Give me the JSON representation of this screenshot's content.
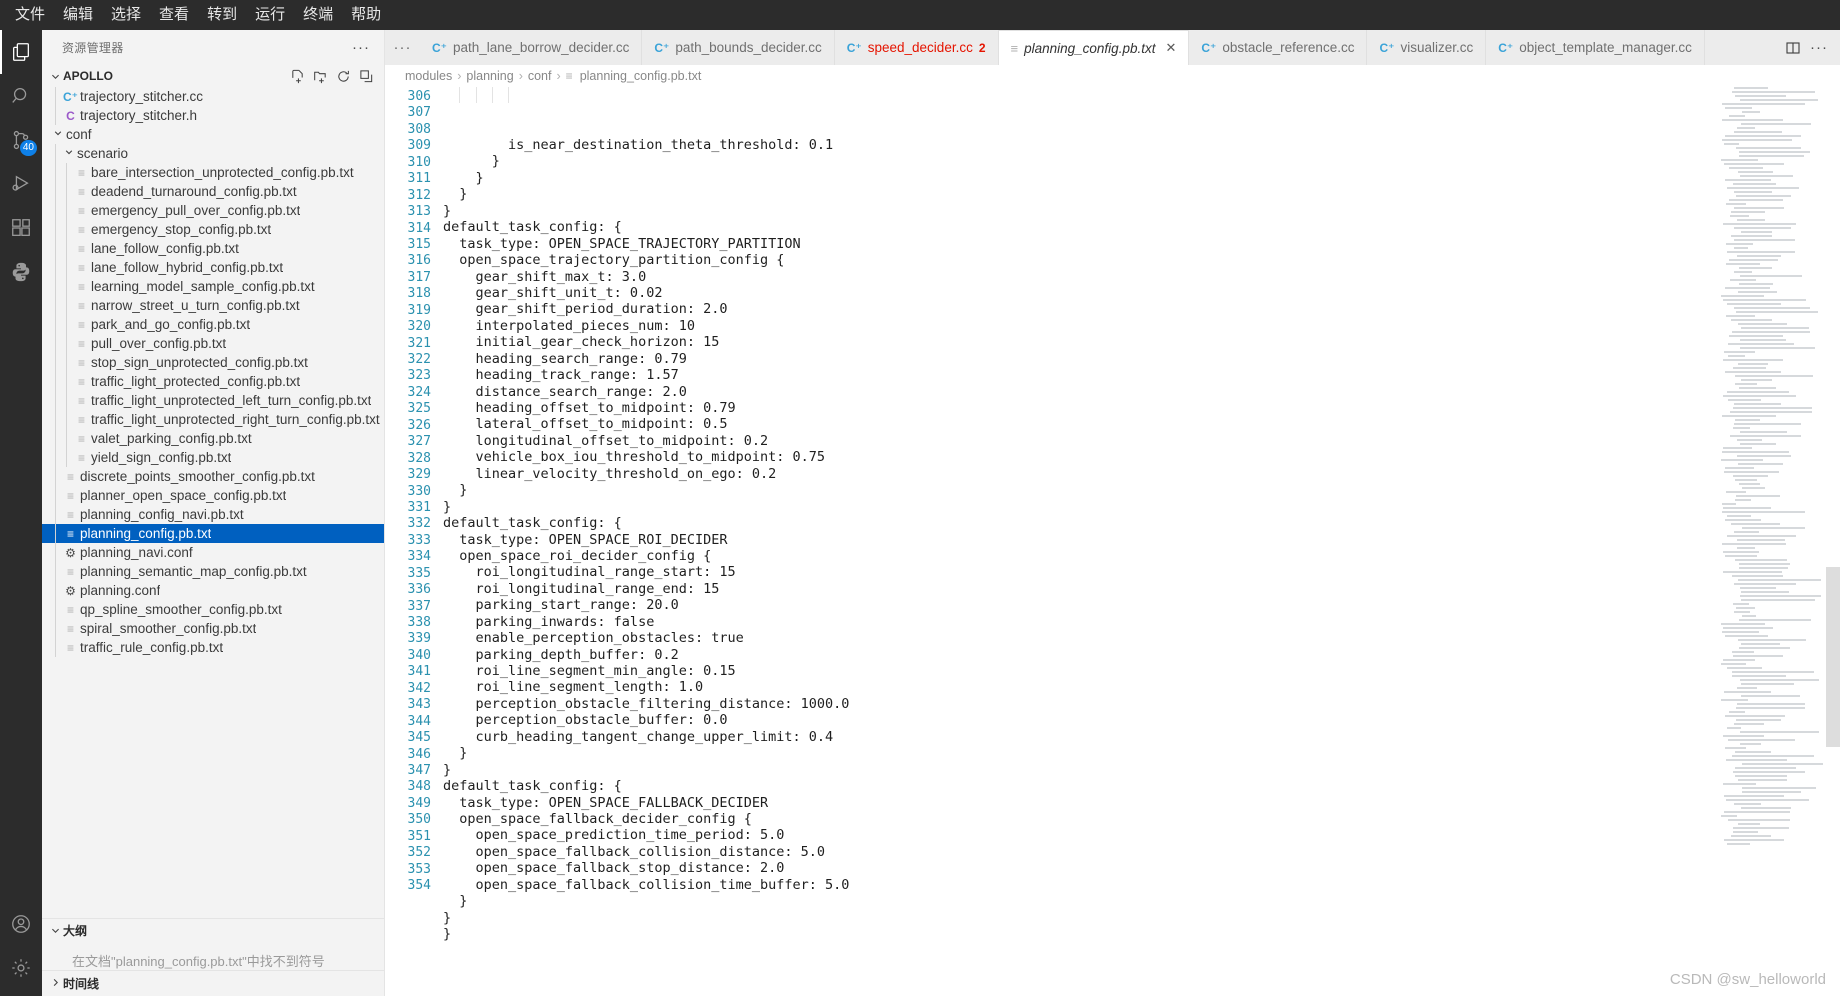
{
  "menubar": {
    "items": [
      "文件",
      "编辑",
      "选择",
      "查看",
      "转到",
      "运行",
      "终端",
      "帮助"
    ]
  },
  "activitybar": {
    "items": [
      {
        "name": "explorer",
        "icon": "files-icon",
        "active": true,
        "badge": null
      },
      {
        "name": "search",
        "icon": "search-icon",
        "active": false,
        "badge": null
      },
      {
        "name": "source-control",
        "icon": "source-control-icon",
        "active": false,
        "badge": "40"
      },
      {
        "name": "run-debug",
        "icon": "run-and-debug-icon",
        "active": false,
        "badge": null
      },
      {
        "name": "extensions",
        "icon": "extensions-icon",
        "active": false,
        "badge": null
      },
      {
        "name": "python",
        "icon": "python-icon",
        "active": false,
        "badge": null
      }
    ],
    "bottom": [
      {
        "name": "accounts",
        "icon": "account-icon"
      },
      {
        "name": "manage",
        "icon": "gear-icon"
      }
    ]
  },
  "sidebar": {
    "title": "资源管理器",
    "more_label": "···",
    "explorer_section": {
      "label": "APOLLO",
      "caret": "⌄",
      "actions": [
        "new-file-icon",
        "new-folder-icon",
        "refresh-icon",
        "collapse-all-icon"
      ]
    },
    "tree": [
      {
        "label": "trajectory_stitcher.cc",
        "icon": "cpp-file-icon",
        "depth": 3,
        "type": "cc"
      },
      {
        "label": "trajectory_stitcher.h",
        "icon": "header-file-icon",
        "depth": 3,
        "type": "h"
      },
      {
        "label": "conf",
        "icon": "folder-icon",
        "depth": 2,
        "type": "folder",
        "expanded": true
      },
      {
        "label": "scenario",
        "icon": "folder-icon",
        "depth": 3,
        "type": "folder",
        "expanded": true
      },
      {
        "label": "bare_intersection_unprotected_config.pb.txt",
        "icon": "text-file-icon",
        "depth": 4,
        "type": "txt"
      },
      {
        "label": "deadend_turnaround_config.pb.txt",
        "icon": "text-file-icon",
        "depth": 4,
        "type": "txt"
      },
      {
        "label": "emergency_pull_over_config.pb.txt",
        "icon": "text-file-icon",
        "depth": 4,
        "type": "txt"
      },
      {
        "label": "emergency_stop_config.pb.txt",
        "icon": "text-file-icon",
        "depth": 4,
        "type": "txt"
      },
      {
        "label": "lane_follow_config.pb.txt",
        "icon": "text-file-icon",
        "depth": 4,
        "type": "txt"
      },
      {
        "label": "lane_follow_hybrid_config.pb.txt",
        "icon": "text-file-icon",
        "depth": 4,
        "type": "txt"
      },
      {
        "label": "learning_model_sample_config.pb.txt",
        "icon": "text-file-icon",
        "depth": 4,
        "type": "txt"
      },
      {
        "label": "narrow_street_u_turn_config.pb.txt",
        "icon": "text-file-icon",
        "depth": 4,
        "type": "txt"
      },
      {
        "label": "park_and_go_config.pb.txt",
        "icon": "text-file-icon",
        "depth": 4,
        "type": "txt"
      },
      {
        "label": "pull_over_config.pb.txt",
        "icon": "text-file-icon",
        "depth": 4,
        "type": "txt"
      },
      {
        "label": "stop_sign_unprotected_config.pb.txt",
        "icon": "text-file-icon",
        "depth": 4,
        "type": "txt"
      },
      {
        "label": "traffic_light_protected_config.pb.txt",
        "icon": "text-file-icon",
        "depth": 4,
        "type": "txt"
      },
      {
        "label": "traffic_light_unprotected_left_turn_config.pb.txt",
        "icon": "text-file-icon",
        "depth": 4,
        "type": "txt"
      },
      {
        "label": "traffic_light_unprotected_right_turn_config.pb.txt",
        "icon": "text-file-icon",
        "depth": 4,
        "type": "txt"
      },
      {
        "label": "valet_parking_config.pb.txt",
        "icon": "text-file-icon",
        "depth": 4,
        "type": "txt"
      },
      {
        "label": "yield_sign_config.pb.txt",
        "icon": "text-file-icon",
        "depth": 4,
        "type": "txt"
      },
      {
        "label": "discrete_points_smoother_config.pb.txt",
        "icon": "text-file-icon",
        "depth": 3,
        "type": "txt"
      },
      {
        "label": "planner_open_space_config.pb.txt",
        "icon": "text-file-icon",
        "depth": 3,
        "type": "txt"
      },
      {
        "label": "planning_config_navi.pb.txt",
        "icon": "text-file-icon",
        "depth": 3,
        "type": "txt"
      },
      {
        "label": "planning_config.pb.txt",
        "icon": "text-file-icon",
        "depth": 3,
        "type": "txt",
        "selected": true
      },
      {
        "label": "planning_navi.conf",
        "icon": "settings-file-icon",
        "depth": 3,
        "type": "conf"
      },
      {
        "label": "planning_semantic_map_config.pb.txt",
        "icon": "text-file-icon",
        "depth": 3,
        "type": "txt"
      },
      {
        "label": "planning.conf",
        "icon": "settings-file-icon",
        "depth": 3,
        "type": "conf"
      },
      {
        "label": "qp_spline_smoother_config.pb.txt",
        "icon": "text-file-icon",
        "depth": 3,
        "type": "txt"
      },
      {
        "label": "spiral_smoother_config.pb.txt",
        "icon": "text-file-icon",
        "depth": 3,
        "type": "txt"
      },
      {
        "label": "traffic_rule_config.pb.txt",
        "icon": "text-file-icon",
        "depth": 3,
        "type": "txt"
      }
    ],
    "outline": {
      "label": "大纲",
      "caret": "⌄",
      "empty_message": "在文档\"planning_config.pb.txt\"中找不到符号"
    },
    "timeline": {
      "label": "时间线",
      "caret": "›"
    }
  },
  "editor": {
    "tabs": [
      {
        "name": "path_lane_borrow_decider.cc",
        "icon": "cpp-file-icon",
        "active": false,
        "error": false,
        "count": null
      },
      {
        "name": "path_bounds_decider.cc",
        "icon": "cpp-file-icon",
        "active": false,
        "error": false,
        "count": null
      },
      {
        "name": "speed_decider.cc",
        "icon": "cpp-file-icon",
        "active": false,
        "error": true,
        "count": "2"
      },
      {
        "name": "planning_config.pb.txt",
        "icon": "text-file-icon",
        "active": true,
        "error": false,
        "count": null,
        "closable": true
      },
      {
        "name": "obstacle_reference.cc",
        "icon": "cpp-file-icon",
        "active": false,
        "error": false,
        "count": null
      },
      {
        "name": "visualizer.cc",
        "icon": "cpp-file-icon",
        "active": false,
        "error": false,
        "count": null
      },
      {
        "name": "object_template_manager.cc",
        "icon": "cpp-file-icon",
        "active": false,
        "error": false,
        "count": null
      }
    ],
    "tab_actions": [
      "split-editor-icon",
      "more-actions-icon"
    ],
    "breadcrumbs": [
      "modules",
      "planning",
      "conf",
      "planning_config.pb.txt"
    ],
    "breadcrumb_sep": "›",
    "first_line_number": 306,
    "lines": [
      "        is_near_destination_theta_threshold: 0.1",
      "      }",
      "    }",
      "  }",
      "}",
      "default_task_config: {",
      "  task_type: OPEN_SPACE_TRAJECTORY_PARTITION",
      "  open_space_trajectory_partition_config {",
      "    gear_shift_max_t: 3.0",
      "    gear_shift_unit_t: 0.02",
      "    gear_shift_period_duration: 2.0",
      "    interpolated_pieces_num: 10",
      "    initial_gear_check_horizon: 15",
      "    heading_search_range: 0.79",
      "    heading_track_range: 1.57",
      "    distance_search_range: 2.0",
      "    heading_offset_to_midpoint: 0.79",
      "    lateral_offset_to_midpoint: 0.5",
      "    longitudinal_offset_to_midpoint: 0.2",
      "    vehicle_box_iou_threshold_to_midpoint: 0.75",
      "    linear_velocity_threshold_on_ego: 0.2",
      "  }",
      "}",
      "default_task_config: {",
      "  task_type: OPEN_SPACE_ROI_DECIDER",
      "  open_space_roi_decider_config {",
      "    roi_longitudinal_range_start: 15",
      "    roi_longitudinal_range_end: 15",
      "    parking_start_range: 20.0",
      "    parking_inwards: false",
      "    enable_perception_obstacles: true",
      "    parking_depth_buffer: 0.2",
      "    roi_line_segment_min_angle: 0.15",
      "    roi_line_segment_length: 1.0",
      "    perception_obstacle_filtering_distance: 1000.0",
      "    perception_obstacle_buffer: 0.0",
      "    curb_heading_tangent_change_upper_limit: 0.4",
      "  }",
      "}",
      "default_task_config: {",
      "  task_type: OPEN_SPACE_FALLBACK_DECIDER",
      "  open_space_fallback_decider_config {",
      "    open_space_prediction_time_period: 5.0",
      "    open_space_fallback_collision_distance: 5.0",
      "    open_space_fallback_stop_distance: 2.0",
      "    open_space_fallback_collision_time_buffer: 5.0",
      "  }",
      "}",
      "}"
    ]
  },
  "watermark": "CSDN @sw_helloworld",
  "colors": {
    "accent": "#0060c0",
    "error": "#e51400",
    "line_number": "#2b91af",
    "badge": "#0e80e8",
    "activity_bg": "#2c2c2c",
    "sidebar_bg": "#f3f3f3",
    "editor_bg": "#ffffff"
  }
}
